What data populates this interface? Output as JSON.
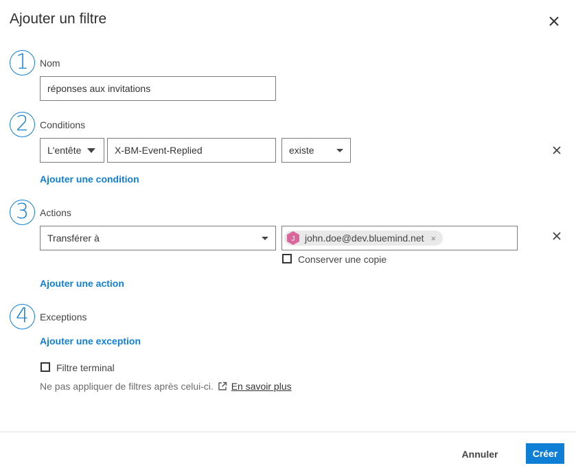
{
  "dialog": {
    "title": "Ajouter un filtre"
  },
  "sections": {
    "name": {
      "number": "1",
      "label": "Nom",
      "value": "réponses aux invitations"
    },
    "conditions": {
      "number": "2",
      "label": "Conditions",
      "header_select": "L'entête",
      "header_value": "X-BM-Event-Replied",
      "operator_select": "existe",
      "add_label": "Ajouter une condition"
    },
    "actions": {
      "number": "3",
      "label": "Actions",
      "action_select": "Transférer à",
      "recipient": {
        "avatar_letter": "J",
        "email": "john.doe@dev.bluemind.net",
        "remove_glyph": "×"
      },
      "keep_copy_label": "Conserver une copie",
      "keep_copy_checked": false,
      "add_label": "Ajouter une action"
    },
    "exceptions": {
      "number": "4",
      "label": "Exceptions",
      "add_label": "Ajouter une exception"
    }
  },
  "terminal": {
    "label": "Filtre terminal",
    "checked": false,
    "hint": "Ne pas appliquer de filtres après celui-ci.",
    "learn_more": "En savoir plus"
  },
  "footer": {
    "cancel_label": "Annuler",
    "create_label": "Créer"
  },
  "icons": {
    "close": "close-icon",
    "remove": "close-icon",
    "external": "external-link-icon",
    "dropdown": "caret-down-icon"
  },
  "colors": {
    "accent": "#0f7ed5",
    "avatar": "#d9679b",
    "chip_bg": "#e9e9e9"
  }
}
